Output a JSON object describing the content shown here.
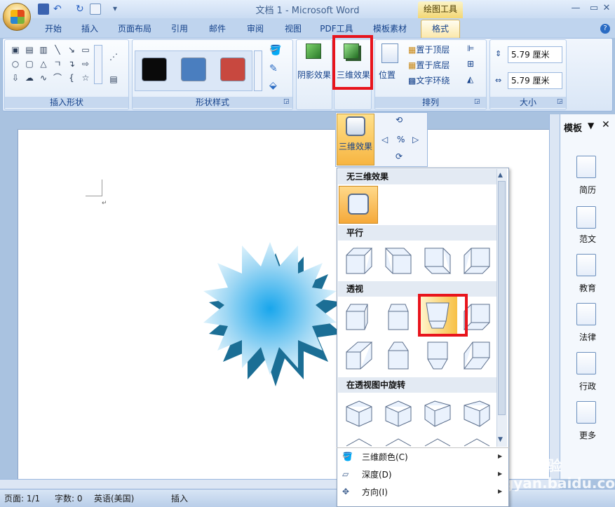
{
  "window": {
    "title": "文档 1 - Microsoft Word",
    "context_tab": "绘图工具"
  },
  "tabs": [
    "开始",
    "插入",
    "页面布局",
    "引用",
    "邮件",
    "审阅",
    "视图",
    "PDF工具",
    "模板素材",
    "格式"
  ],
  "ribbon": {
    "groups": {
      "insert_shapes": "插入形状",
      "shape_styles": "形状样式",
      "arrange": "排列",
      "size": "大小"
    },
    "shadow_effects": "阴影效果",
    "threed_effects": "三维效果",
    "position": "位置",
    "bring_front": "置于顶层",
    "send_back": "置于底层",
    "text_wrap": "文字环绕",
    "height": "5.79 厘米",
    "width": "5.79 厘米"
  },
  "dropdown": {
    "button": "三维效果",
    "sections": {
      "none": "无三维效果",
      "parallel": "平行",
      "perspective": "透视",
      "rotate": "在透视图中旋转"
    },
    "commands": [
      "三维颜色(C)",
      "深度(D)",
      "方向(I)"
    ]
  },
  "panel": {
    "title": "模板",
    "items": [
      "简历",
      "范文",
      "教育",
      "法律",
      "行政",
      "更多"
    ]
  },
  "status": {
    "page": "页面: 1/1",
    "words": "字数: 0",
    "lang": "英语(美国)",
    "mode": "插入"
  },
  "watermark": "Baidu 经验 jingyan.baidu.com",
  "colors": {
    "swatch1": "#0a0a0a",
    "swatch2": "#4a7ebf",
    "swatch3": "#c8483f",
    "highlight": "#e8141c"
  }
}
